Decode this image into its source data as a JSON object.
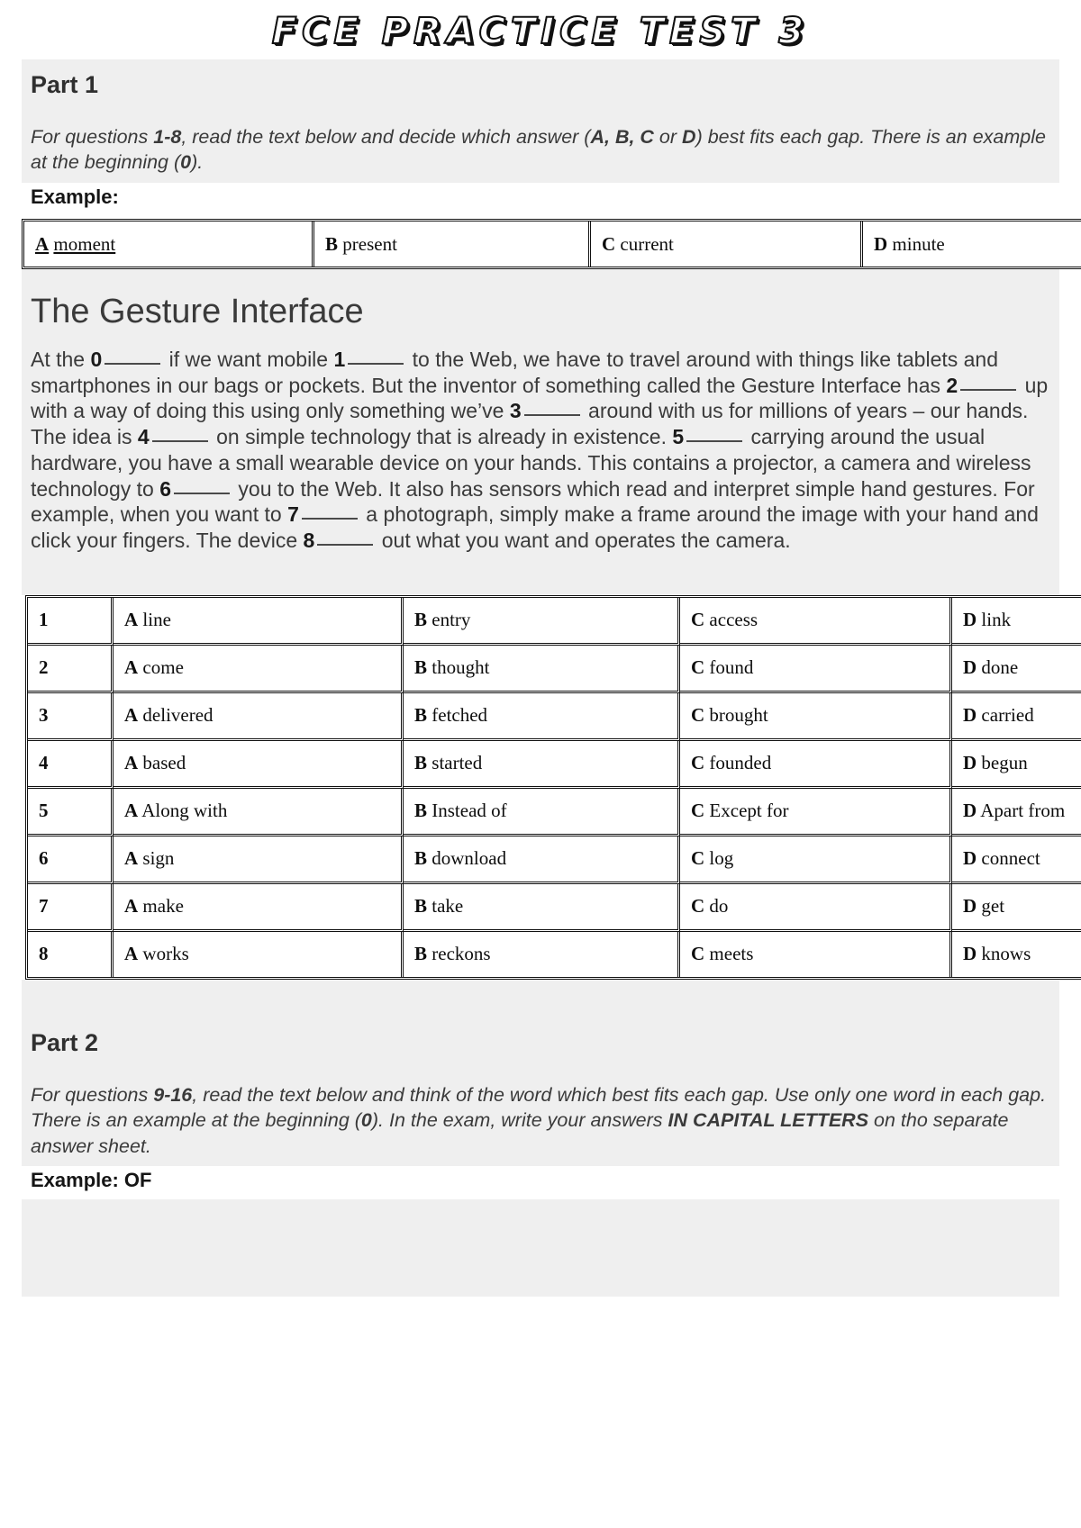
{
  "document": {
    "title": "FCE PRACTICE TEST 3"
  },
  "part1": {
    "heading": "Part 1",
    "instructions_pre": "For questions ",
    "instructions_range": "1-8",
    "instructions_mid": ", read the text below and decide which answer (",
    "instructions_opts": "A, B, C",
    "instructions_or": " or ",
    "instructions_d": "D",
    "instructions_post": ") best fits each gap. There is an example at the beginning (",
    "instructions_zero": "0",
    "instructions_end": ").",
    "instructions_full": "For questions 1-8, read the text below and decide which answer (A, B, C or D) best fits each gap. There is an example at the beginning (0).",
    "example_label": "Example:",
    "example_row": {
      "a": "moment",
      "b": "present",
      "c": "current",
      "d": "minute",
      "correct": "A"
    },
    "article": {
      "title": "The Gesture Interface",
      "paragraph1_parts": [
        "At the ",
        "0",
        " ",
        " if we want mobile ",
        "1",
        " ",
        " to the Web, we have to travel around with things like tablets and smartphones in our bags or pockets. But the inventor of something called the Gesture Interface has ",
        "2",
        " ",
        " up with a way of doing this using only something we’ve ",
        "3",
        " ",
        " around with us for millions of years – our hands."
      ],
      "paragraph1_text": "At the 0 _____ if we want mobile 1 _____ to the Web, we have to travel around with things like tablets and smartphones in our bags or pockets. But the inventor of something called the Gesture Interface has 2 _____ up with a way of doing this using only something we’ve 3 _____ around with us for millions of years – our hands.",
      "paragraph2_text": "The idea is 4 _____ on simple technology that is already in existence. 5 _____ carrying around the usual hardware, you have a small wearable device on your hands. This contains a projector, a camera and wireless technology to 6 _____ you to the Web. It also has sensors which read and interpret simple hand gestures. For example, when you want to 7 _____ a photograph, simply make a frame around the image with your hand and click your fingers. The device 8 _____ out what you want and operates the camera.",
      "p1_seg": {
        "s1": "At the ",
        "n1": "0",
        "s2": " if we want mobile ",
        "n2": "1",
        "s3": " to the Web, we have to travel around with things like tablets and smartphones in our bags or pockets. But the inventor of something called the Gesture Interface has ",
        "n3": "2",
        "s4": " up with a way of doing this using only something we’ve ",
        "n4": "3",
        "s5": " around with us for millions of years – our hands."
      },
      "p2_seg": {
        "s1": "The idea is ",
        "n1": "4",
        "s2": " on simple technology that is already in existence. ",
        "n2": "5",
        "s3": " carrying around the usual hardware, you have a small wearable device on your hands. This contains a projector, a camera and wireless technology to ",
        "n3": "6",
        "s4": " you to the Web. It also has sensors which read and interpret simple hand gestures. For example, when you want to ",
        "n4": "7",
        "s5": " a photograph, simply make a frame around the image with your hand and click your fingers. The device ",
        "n5": "8",
        "s6": " out what you want and operates the camera."
      }
    },
    "options_table": {
      "rows": [
        {
          "num": "1",
          "a": "line",
          "b": "entry",
          "c": "access",
          "d": "link"
        },
        {
          "num": "2",
          "a": "come",
          "b": "thought",
          "c": "found",
          "d": "done"
        },
        {
          "num": "3",
          "a": "delivered",
          "b": "fetched",
          "c": "brought",
          "d": "carried"
        },
        {
          "num": "4",
          "a": "based",
          "b": "started",
          "c": "founded",
          "d": "begun"
        },
        {
          "num": "5",
          "a": "Along with",
          "b": "Instead of",
          "c": "Except for",
          "d": "Apart from"
        },
        {
          "num": "6",
          "a": "sign",
          "b": "download",
          "c": "log",
          "d": "connect"
        },
        {
          "num": "7",
          "a": "make",
          "b": "take",
          "c": "do",
          "d": "get"
        },
        {
          "num": "8",
          "a": "works",
          "b": "reckons",
          "c": "meets",
          "d": "knows"
        }
      ],
      "letters": {
        "a": "A",
        "b": "B",
        "c": "C",
        "d": "D"
      }
    }
  },
  "part2": {
    "heading": "Part 2",
    "instr": {
      "s1": "For questions ",
      "b1": "9-16",
      "s2": ", read the text below and think of the word which best fits each gap. Use only one word in each gap. There is an example at the beginning (",
      "b2": "0",
      "s3": "). In the exam, write your answers ",
      "b3": "IN CAPITAL LETTERS",
      "s4": " on tho separate answer sheet."
    },
    "instructions_full": "For questions 9-16, read the text below and think of the word which best fits each gap. Use only one word in each gap. There is an example at the beginning (0). In the exam, write your answers IN CAPITAL LETTERS on tho separate answer sheet.",
    "example_label": "Example: OF"
  },
  "colors": {
    "band_background": "#efefef",
    "page_background": "#ffffff",
    "body_text": "#3a3a3a",
    "table_text": "#0d0d0d",
    "border": "#111111"
  }
}
